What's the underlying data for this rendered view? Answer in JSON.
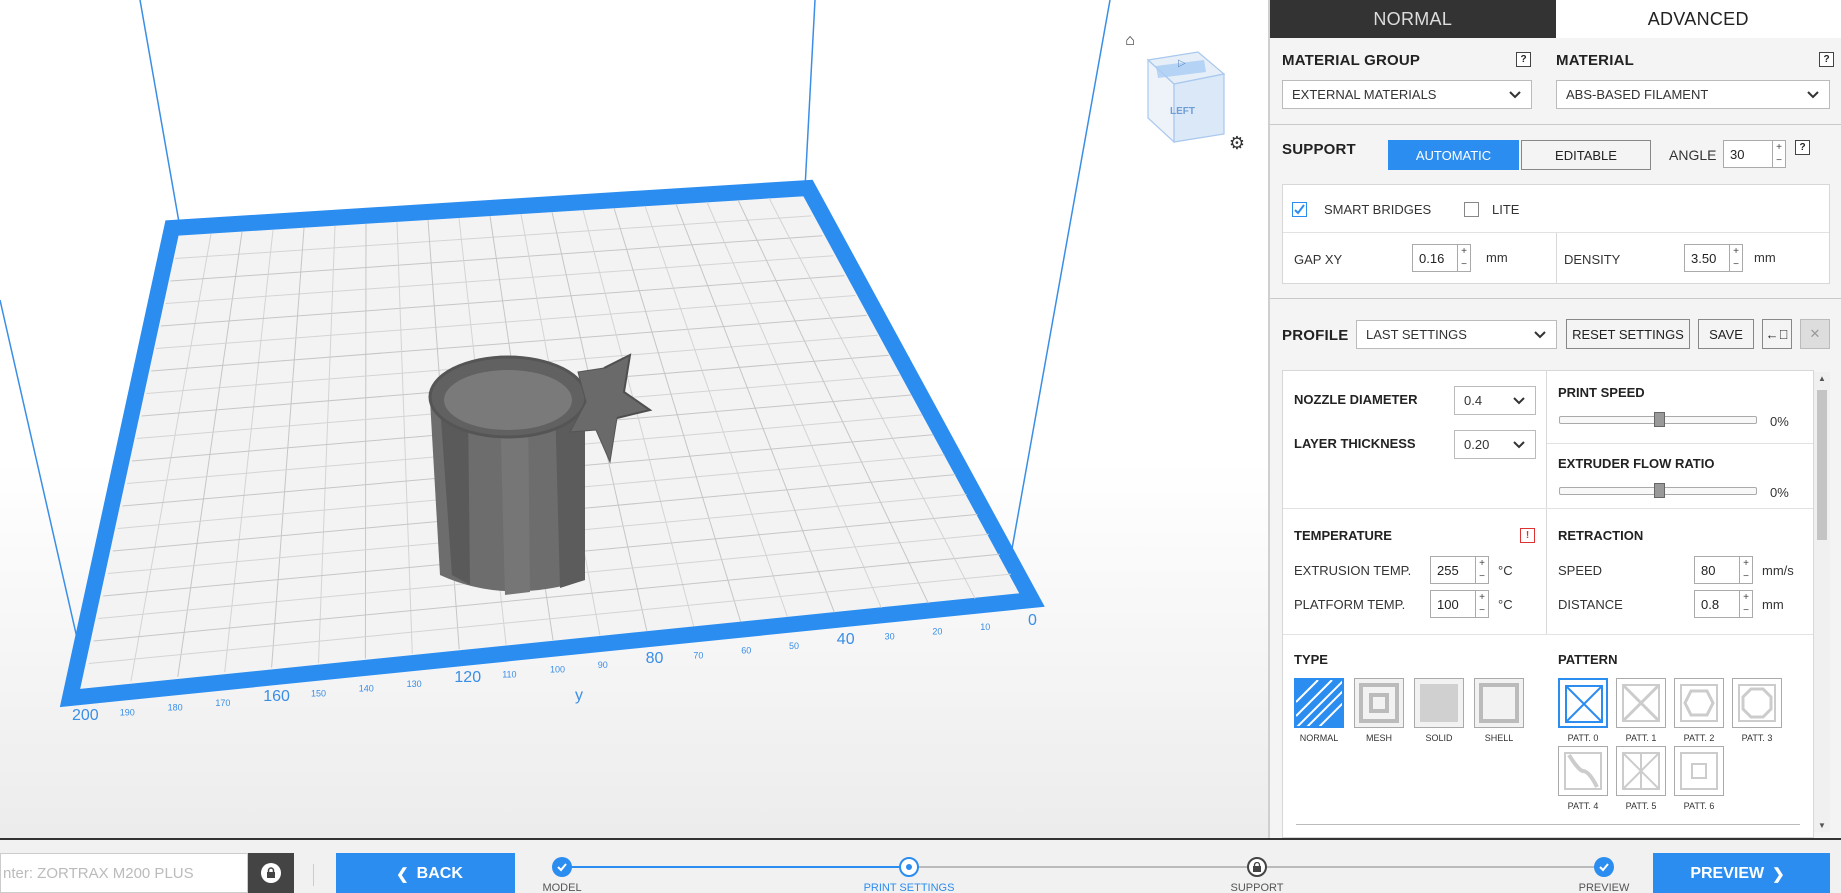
{
  "window": {
    "mode_tabs": [
      {
        "label": "NORMAL",
        "active": false
      },
      {
        "label": "ADVANCED",
        "active": true
      }
    ]
  },
  "viewport": {
    "view_cube_label": "LEFT",
    "axis_major_labels": [
      "200",
      "160",
      "120",
      "80",
      "40",
      "0"
    ],
    "axis_minor_labels": [
      "190",
      "180",
      "170",
      "150",
      "140",
      "130",
      "110",
      "100",
      "90",
      "70",
      "60",
      "50",
      "30",
      "20",
      "10"
    ],
    "axis_name": "y",
    "icons": {
      "home": "home-icon",
      "settings": "gear-icon"
    },
    "colors": {
      "build_plate_border": "#2c8df0",
      "model": "#6b6b6b"
    }
  },
  "material": {
    "group_label": "MATERIAL GROUP",
    "group_value": "EXTERNAL MATERIALS",
    "material_label": "MATERIAL",
    "material_value": "ABS-BASED FILAMENT",
    "help": "?"
  },
  "support": {
    "label": "SUPPORT",
    "automatic": "AUTOMATIC",
    "editable": "EDITABLE",
    "angle_label": "ANGLE",
    "angle_value": "30",
    "smart_bridges_label": "SMART BRIDGES",
    "smart_bridges_checked": true,
    "lite_label": "LITE",
    "lite_checked": false,
    "gap_label": "GAP XY",
    "gap_value": "0.16",
    "gap_unit": "mm",
    "density_label": "DENSITY",
    "density_value": "3.50",
    "density_unit": "mm"
  },
  "profile": {
    "label": "PROFILE",
    "value": "LAST SETTINGS",
    "reset": "RESET SETTINGS",
    "save": "SAVE"
  },
  "settings": {
    "nozzle_label": "NOZZLE DIAMETER",
    "nozzle_value": "0.4",
    "layer_label": "LAYER THICKNESS",
    "layer_value": "0.20",
    "print_speed_label": "PRINT SPEED",
    "print_speed_value": "0%",
    "print_speed_level": 0.5,
    "flow_label": "EXTRUDER FLOW RATIO",
    "flow_value": "0%",
    "flow_level": 0.5,
    "temp_label": "TEMPERATURE",
    "warning": "!",
    "extrusion_label": "EXTRUSION TEMP.",
    "extrusion_value": "255",
    "platform_label": "PLATFORM TEMP.",
    "platform_value": "100",
    "temp_unit": "°C",
    "retraction_label": "RETRACTION",
    "speed_label": "SPEED",
    "speed_value": "80",
    "speed_unit": "mm/s",
    "distance_label": "DISTANCE",
    "distance_value": "0.8",
    "distance_unit": "mm",
    "type_label": "TYPE",
    "types": [
      "NORMAL",
      "MESH",
      "SOLID",
      "SHELL"
    ],
    "pattern_label": "PATTERN",
    "patterns": [
      "PATT. 0",
      "PATT. 1",
      "PATT. 2",
      "PATT. 3",
      "PATT. 4",
      "PATT. 5",
      "PATT. 6"
    ]
  },
  "bottom": {
    "printer_placeholder": "nter: ZORTRAX M200 PLUS",
    "back": "BACK",
    "preview_btn": "PREVIEW",
    "steps": [
      {
        "label": "MODEL",
        "state": "done"
      },
      {
        "label": "PRINT SETTINGS",
        "state": "current"
      },
      {
        "label": "SUPPORT",
        "state": "pending"
      },
      {
        "label": "PREVIEW",
        "state": "done"
      }
    ],
    "accent": "#2c8df0"
  }
}
